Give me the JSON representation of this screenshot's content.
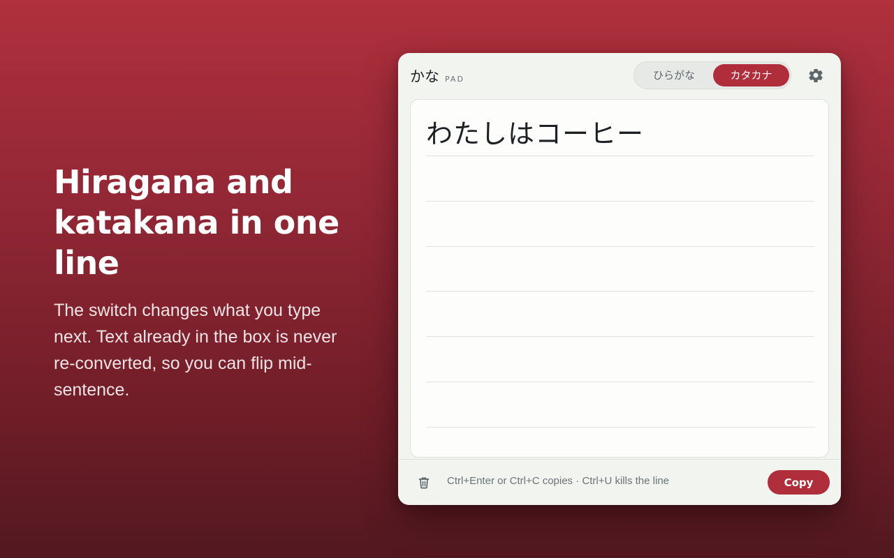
{
  "promo": {
    "heading": "Hiragana and katakana in one line",
    "body": "The switch changes what you type next. Text already in the box is never re-converted, so you can flip mid-sentence."
  },
  "app": {
    "brand": {
      "name": "かな",
      "suffix": "PAD"
    },
    "mode_toggle": {
      "options": [
        "ひらがな",
        "カタカナ"
      ],
      "selected": "カタカナ"
    },
    "settings_icon": "gear-icon",
    "editor": {
      "text": "わたしはコーヒー"
    },
    "footer": {
      "clear_icon": "trash-icon",
      "hint": "Ctrl+Enter or Ctrl+C copies · Ctrl+U kills the line",
      "copy_label": "Copy"
    }
  },
  "colors": {
    "accent": "#b02e3b",
    "background_top": "#b0303d",
    "background_bottom": "#521820",
    "panel": "#f2f4f0"
  }
}
